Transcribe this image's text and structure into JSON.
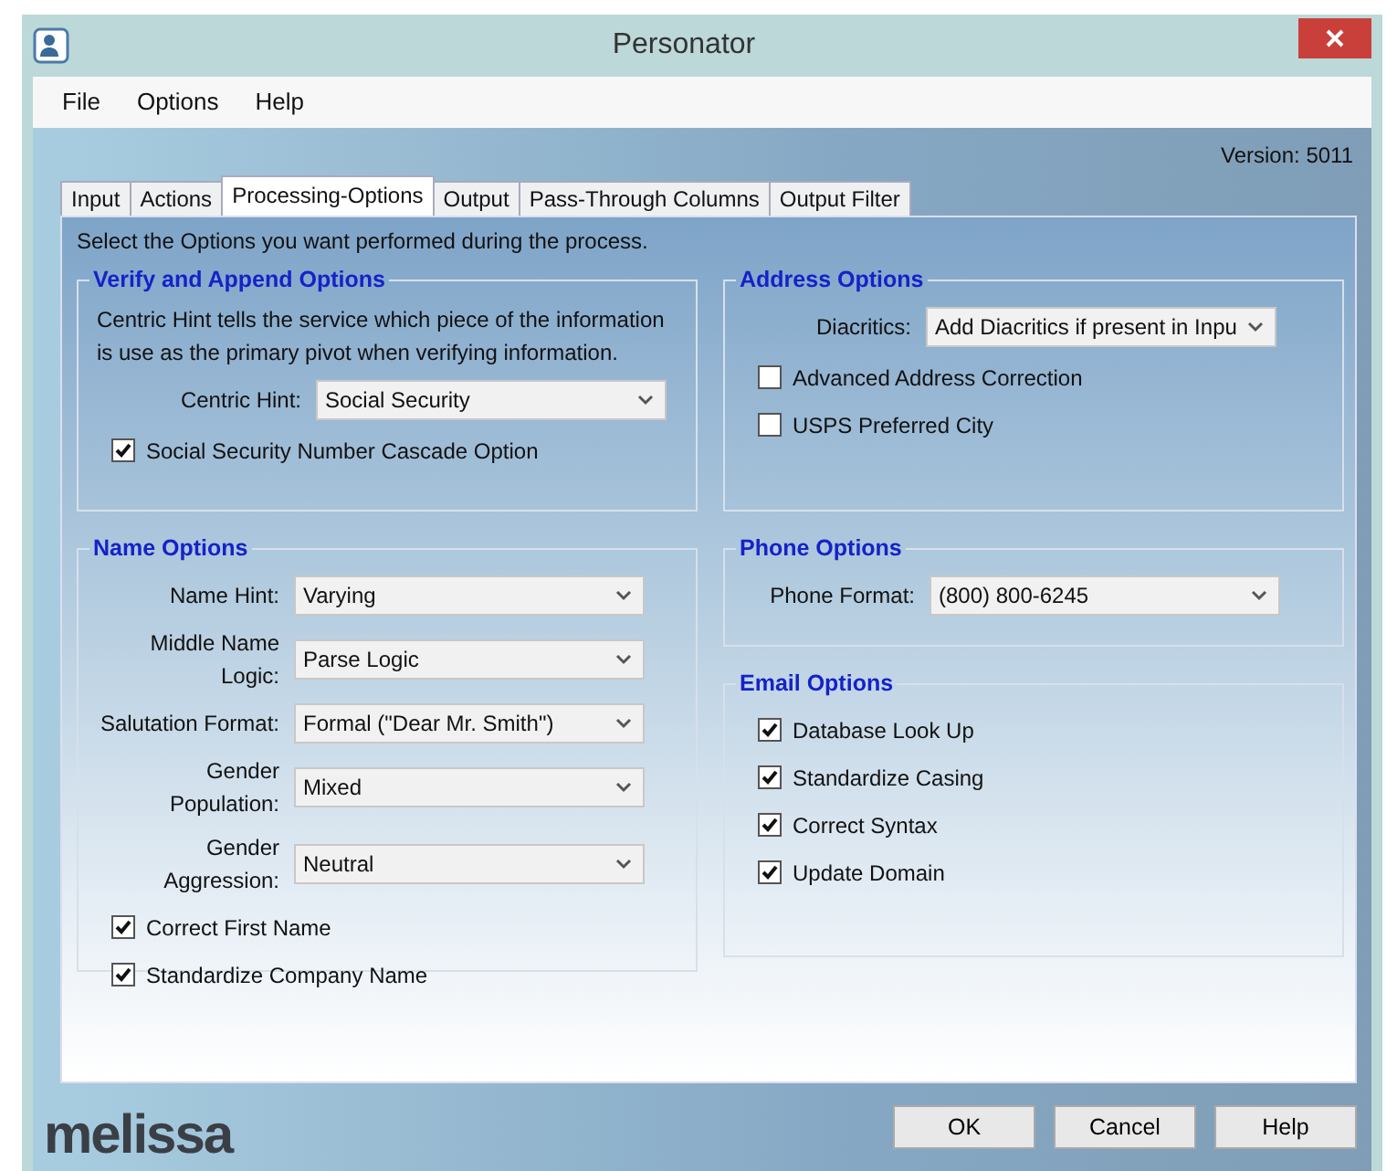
{
  "window": {
    "title": "Personator"
  },
  "menu": [
    "File",
    "Options",
    "Help"
  ],
  "version": "Version: 5011",
  "tabs": [
    {
      "label": "Input",
      "selected": false
    },
    {
      "label": "Actions",
      "selected": false
    },
    {
      "label": "Processing-Options",
      "selected": true
    },
    {
      "label": "Output",
      "selected": false
    },
    {
      "label": "Pass-Through Columns",
      "selected": false
    },
    {
      "label": "Output Filter",
      "selected": false
    }
  ],
  "instruction": "Select the Options you want performed during the process.",
  "left_groups": [
    {
      "title": "Verify and Append Options",
      "description": "Centric Hint tells the service which piece of the information is use as the primary pivot when verifying information.",
      "fields": [
        {
          "label": "Centric Hint:",
          "value": "Social Security"
        }
      ],
      "checkboxes": [
        {
          "label": "Social Security Number Cascade Option",
          "checked": true
        }
      ]
    },
    {
      "title": "Name Options",
      "fields": [
        {
          "label": "Name Hint:",
          "value": "Varying"
        },
        {
          "label": "Middle Name Logic:",
          "value": "Parse Logic"
        },
        {
          "label": "Salutation Format:",
          "value": "Formal (\"Dear Mr. Smith\")"
        },
        {
          "label": "Gender Population:",
          "value": "Mixed"
        },
        {
          "label": "Gender Aggression:",
          "value": "Neutral"
        }
      ],
      "checkboxes": [
        {
          "label": "Correct First Name",
          "checked": true
        },
        {
          "label": "Standardize Company Name",
          "checked": true
        }
      ]
    }
  ],
  "right_groups": [
    {
      "title": "Address Options",
      "fields": [
        {
          "label": "Diacritics:",
          "value": "Add Diacritics if present in Inpu"
        }
      ],
      "checkboxes": [
        {
          "label": "Advanced Address Correction",
          "checked": false
        },
        {
          "label": "USPS Preferred City",
          "checked": false
        }
      ]
    },
    {
      "title": "Phone Options",
      "fields": [
        {
          "label": "Phone Format:",
          "value": "(800) 800-6245"
        }
      ]
    },
    {
      "title": "Email Options",
      "checkboxes": [
        {
          "label": "Database Look Up",
          "checked": true
        },
        {
          "label": "Standardize Casing",
          "checked": true
        },
        {
          "label": "Correct Syntax",
          "checked": true
        },
        {
          "label": "Update Domain",
          "checked": true
        }
      ]
    }
  ],
  "logo": "melissa",
  "buttons": [
    "OK",
    "Cancel",
    "Help"
  ]
}
